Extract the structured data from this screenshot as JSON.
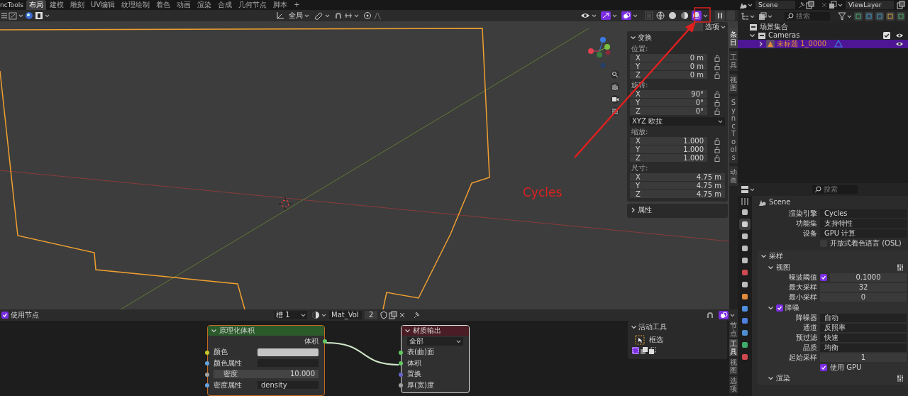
{
  "top_bar": {
    "app_label": "ncTools",
    "workspaces": [
      {
        "label": "布局",
        "selected": true
      },
      {
        "label": "建模",
        "selected": false
      },
      {
        "label": "雕刻",
        "selected": false
      },
      {
        "label": "UV编辑",
        "selected": false
      },
      {
        "label": "纹理绘制",
        "selected": false
      },
      {
        "label": "着色",
        "selected": false
      },
      {
        "label": "动画",
        "selected": false
      },
      {
        "label": "渲染",
        "selected": false
      },
      {
        "label": "合成",
        "selected": false
      },
      {
        "label": "几何节点",
        "selected": false
      },
      {
        "label": "脚本",
        "selected": false
      }
    ],
    "add_tab": "+",
    "scene": "Scene",
    "view_layer": "ViewLayer"
  },
  "viewport": {
    "orientation": "全局",
    "shading_modes": [
      {
        "selected": false
      },
      {
        "selected": false
      },
      {
        "selected": false
      },
      {
        "selected": true
      }
    ],
    "options_button": "选项",
    "annotation": "Cycles",
    "side_tabs": [
      {
        "label": "条目",
        "selected": true
      },
      {
        "label": "工具",
        "selected": false
      },
      {
        "label": "视图",
        "selected": false
      },
      {
        "label": "SyncTools",
        "selected": false
      },
      {
        "label": "动画",
        "selected": false
      }
    ],
    "n_panel": {
      "transform": {
        "title": "变换",
        "expanded": true,
        "groups": [
          {
            "kind": "vector",
            "label": "位置:",
            "lockable": true,
            "fields": [
              {
                "axis": "X",
                "value": "0 m"
              },
              {
                "axis": "Y",
                "value": "0 m"
              },
              {
                "axis": "Z",
                "value": "0 m"
              }
            ]
          },
          {
            "kind": "vector",
            "label": "旋转:",
            "lockable": true,
            "fields": [
              {
                "axis": "X",
                "value": "90°"
              },
              {
                "axis": "Y",
                "value": "0°"
              },
              {
                "axis": "Z",
                "value": "0°"
              }
            ]
          },
          {
            "kind": "dropdown",
            "value": "XYZ 欧拉"
          },
          {
            "kind": "vector",
            "label": "缩放:",
            "lockable": true,
            "fields": [
              {
                "axis": "X",
                "value": "1.000"
              },
              {
                "axis": "Y",
                "value": "1.000"
              },
              {
                "axis": "Z",
                "value": "1.000"
              }
            ]
          },
          {
            "kind": "vector",
            "label": "尺寸:",
            "lockable": false,
            "fields": [
              {
                "axis": "X",
                "value": "4.75 m"
              },
              {
                "axis": "Y",
                "value": "4.75 m"
              },
              {
                "axis": "Z",
                "value": "4.75 m"
              }
            ]
          }
        ]
      },
      "attributes": {
        "title": "属性",
        "expanded": false
      }
    }
  },
  "outliner": {
    "search_placeholder": "搜索",
    "tree": [
      {
        "label": "场景集合",
        "kind": "collection",
        "selected": false,
        "children": [
          {
            "label": "Cameras",
            "kind": "collection",
            "expanded": true,
            "checked": true,
            "visible": true,
            "selected": false,
            "children": [
              {
                "label": "未标题 1_0000",
                "kind": "camera",
                "expanded": false,
                "visible": true,
                "selected": true
              }
            ]
          }
        ]
      }
    ]
  },
  "properties": {
    "search_placeholder": "搜索",
    "context": "Scene",
    "tabs": [
      {
        "color": "#bdbdbd",
        "selected": false
      },
      {
        "color": "#cfcfcf",
        "selected": true
      },
      {
        "color": "#bdbdbd",
        "selected": false
      },
      {
        "color": "#bdbdbd",
        "selected": false
      },
      {
        "color": "#bdbdbd",
        "selected": false
      },
      {
        "color": "#d0484f",
        "selected": false
      },
      {
        "color": "#bdbdbd",
        "selected": false
      },
      {
        "color": "#e08a3c",
        "selected": false
      },
      {
        "color": "#4f8fe0",
        "selected": false
      },
      {
        "color": "#4f7fe0",
        "selected": false
      },
      {
        "color": "#4f8fd0",
        "selected": false
      },
      {
        "color": "#3fae6a",
        "selected": false
      },
      {
        "color": "#d0484f",
        "selected": false
      }
    ],
    "rows": [
      {
        "kind": "dropdown",
        "label": "渲染引擎",
        "value": "Cycles"
      },
      {
        "kind": "dropdown",
        "label": "功能集",
        "value": "支持特性"
      },
      {
        "kind": "dropdown",
        "label": "设备",
        "value": "GPU 计算"
      },
      {
        "kind": "checkbox",
        "label": "开放式着色语言 (OSL)",
        "checked": false
      }
    ],
    "panels": [
      {
        "title": "采样",
        "expanded": true,
        "subpanels": [
          {
            "title": "视图",
            "expanded": true,
            "rows": [
              {
                "kind": "number_toggle",
                "label": "噪波阈值",
                "value": "0.1000",
                "checked": true
              },
              {
                "kind": "number",
                "label": "最大采样",
                "value": "32"
              },
              {
                "kind": "number",
                "label": "最小采样",
                "value": "0"
              }
            ]
          },
          {
            "title": "降噪",
            "expanded": true,
            "checked": true,
            "rows": [
              {
                "kind": "dropdown",
                "label": "降噪器",
                "value": "自动"
              },
              {
                "kind": "dropdown",
                "label": "通道",
                "value": "反照率"
              },
              {
                "kind": "dropdown",
                "label": "预过滤",
                "value": "快速"
              },
              {
                "kind": "dropdown",
                "label": "品质",
                "value": "均衡"
              },
              {
                "kind": "number",
                "label": "起始采样",
                "value": "1"
              },
              {
                "kind": "checkbox",
                "label": "使用 GPU",
                "checked": true
              }
            ]
          },
          {
            "title": "渲染",
            "expanded": true
          }
        ]
      }
    ]
  },
  "node_editor": {
    "use_nodes": {
      "label": "使用节点",
      "checked": true
    },
    "slot": "槽 1",
    "material": "Mat_Vol",
    "users": "2",
    "nodes": [
      {
        "title": "原理化体积",
        "kind": "shader",
        "rows": [
          {
            "kind": "output",
            "label": "体积",
            "color": "#63c763"
          },
          {
            "kind": "color",
            "label": "颜色",
            "color": "#c7c729"
          },
          {
            "kind": "field",
            "label": "颜色属性",
            "color": "#63a4e0"
          },
          {
            "kind": "slider",
            "label": "密度",
            "color": "#a1a1a1",
            "value": "10.000"
          },
          {
            "kind": "field",
            "label": "密度属性",
            "color": "#63a4e0",
            "value": "density"
          }
        ]
      },
      {
        "title": "材质输出",
        "kind": "output",
        "rows": [
          {
            "kind": "dropdown",
            "value": "全部"
          },
          {
            "kind": "input",
            "label": "表(曲)面",
            "color": "#63c763"
          },
          {
            "kind": "input",
            "label": "体积",
            "color": "#63c763"
          },
          {
            "kind": "input",
            "label": "置换",
            "color": "#6363c7"
          },
          {
            "kind": "input",
            "label": "厚(宽)度",
            "color": "#a1a1a1"
          }
        ]
      }
    ],
    "active_tool": {
      "title": "活动工具",
      "tool": "框选"
    },
    "side_tabs": [
      {
        "label": "节点",
        "selected": false
      },
      {
        "label": "工具",
        "selected": true
      },
      {
        "label": "视图",
        "selected": false
      },
      {
        "label": "选项",
        "selected": false
      }
    ]
  }
}
